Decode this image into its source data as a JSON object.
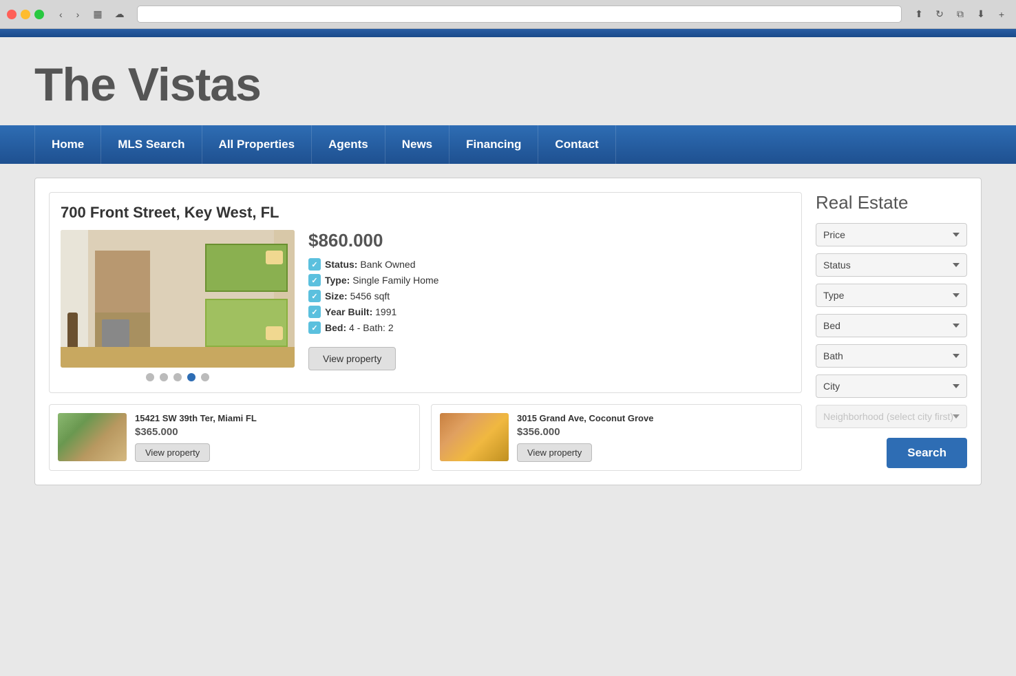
{
  "browser": {
    "back_label": "‹",
    "forward_label": "›",
    "sidebar_label": "▦",
    "cloud_icon": "☁",
    "share_icon": "⬆",
    "refresh_icon": "↻",
    "copy_icon": "⧉",
    "download_icon": "⬇",
    "new_tab_icon": "+"
  },
  "site": {
    "title": "The Vistas",
    "top_bar_color": "#2a5ea3"
  },
  "nav": {
    "items": [
      {
        "label": "Home",
        "id": "home"
      },
      {
        "label": "MLS Search",
        "id": "mls-search"
      },
      {
        "label": "All Properties",
        "id": "all-properties"
      },
      {
        "label": "Agents",
        "id": "agents"
      },
      {
        "label": "News",
        "id": "news"
      },
      {
        "label": "Financing",
        "id": "financing"
      },
      {
        "label": "Contact",
        "id": "contact"
      }
    ]
  },
  "featured": {
    "address": "700 Front Street, Key West, FL",
    "price": "$860.000",
    "status_label": "Status:",
    "status_value": "Bank Owned",
    "type_label": "Type:",
    "type_value": "Single Family Home",
    "size_label": "Size:",
    "size_value": "5456 sqft",
    "year_label": "Year Built:",
    "year_value": "1991",
    "bedpath_label": "Bed:",
    "bedpath_value": "4 - Bath: 2",
    "view_button": "View property",
    "dots": 5,
    "active_dot": 3
  },
  "small_listings": [
    {
      "address": "15421 SW 39th Ter, Miami FL",
      "price": "$365.000",
      "view_button": "View property"
    },
    {
      "address": "3015 Grand Ave, Coconut Grove",
      "price": "$356.000",
      "view_button": "View property"
    }
  ],
  "sidebar": {
    "title": "Real Estate",
    "filters": [
      {
        "id": "price",
        "label": "Price",
        "enabled": true
      },
      {
        "id": "status",
        "label": "Status",
        "enabled": true
      },
      {
        "id": "type",
        "label": "Type",
        "enabled": true
      },
      {
        "id": "bed",
        "label": "Bed",
        "enabled": true
      },
      {
        "id": "bath",
        "label": "Bath",
        "enabled": true
      },
      {
        "id": "city",
        "label": "City",
        "enabled": true
      },
      {
        "id": "neighborhood",
        "label": "Neighborhood (select city first)",
        "enabled": false
      }
    ],
    "search_button": "Search"
  }
}
